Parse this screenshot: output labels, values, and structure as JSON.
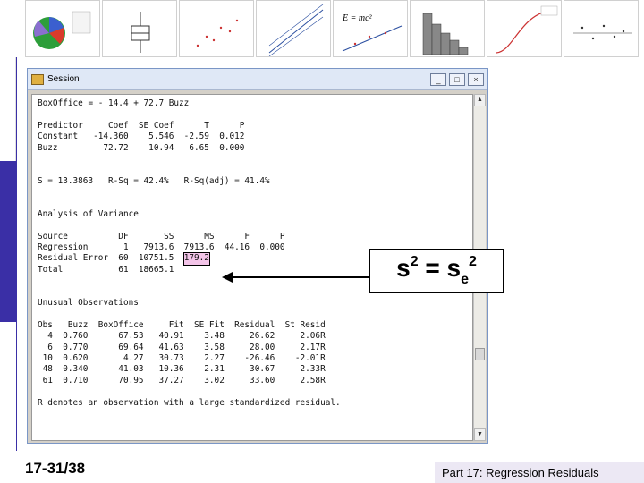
{
  "window": {
    "title": "Session",
    "min_label": "_",
    "max_label": "□",
    "close_label": "×"
  },
  "output_lines": [
    "BoxOffice = - 14.4 + 72.7 Buzz",
    "",
    "Predictor     Coef  SE Coef      T      P",
    "Constant   -14.360    5.546  -2.59  0.012",
    "Buzz         72.72    10.94   6.65  0.000",
    "",
    "",
    "S = 13.3863   R-Sq = 42.4%   R-Sq(adj) = 41.4%",
    "",
    "",
    "Analysis of Variance",
    "",
    "Source          DF       SS      MS      F      P",
    "Regression       1   7913.6  7913.6  44.16  0.000",
    "Residual Error  60  10751.5  ",
    "Total           61  18665.1",
    "",
    "",
    "Unusual Observations",
    "",
    "Obs   Buzz  BoxOffice     Fit  SE Fit  Residual  St Resid",
    "  4  0.760      67.53   40.91    3.48     26.62     2.06R",
    "  6  0.770      69.64   41.63    3.58     28.00     2.17R",
    " 10  0.620       4.27   30.73    2.27    -26.46    -2.01R",
    " 48  0.340      41.03   10.36    2.31     30.67     2.33R",
    " 61  0.710      70.95   37.27    3.02     33.60     2.58R",
    "",
    "R denotes an observation with a large standardized residual."
  ],
  "highlight_value": "179.2",
  "callout": {
    "left": "s",
    "left_sup": "2",
    "eq": " = s",
    "sub": "e",
    "sup": "2"
  },
  "footer": {
    "slide_number": "17-31/38",
    "section_title": "Part 17: Regression Residuals"
  },
  "colors": {
    "accent_band": "#3a2fa6",
    "highlight": "#f3c4e8"
  }
}
